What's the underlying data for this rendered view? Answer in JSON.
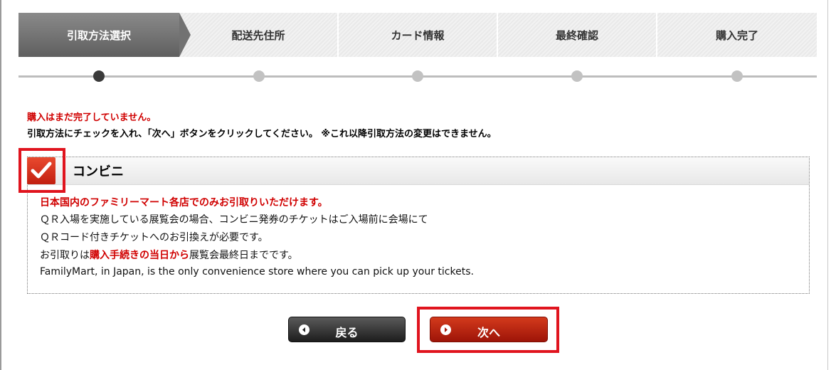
{
  "steps": [
    {
      "label": "引取方法選択",
      "active": true
    },
    {
      "label": "配送先住所",
      "active": false
    },
    {
      "label": "カード情報",
      "active": false
    },
    {
      "label": "最終確認",
      "active": false
    },
    {
      "label": "購入完了",
      "active": false
    }
  ],
  "notice": {
    "warning": "購入はまだ完了していません。",
    "instruction": "引取方法にチェックを入れ、「次へ」ボタンをクリックしてください。 ※これ以降引取方法の変更はできません。"
  },
  "option": {
    "checked": true,
    "label": "コンビニ",
    "note_red": "日本国内のファミリーマート各店でのみお引取りいただけます。",
    "line1": "ＱＲ入場を実施している展覧会の場合、コンビニ発券のチケットはご入場前に会場にて",
    "line2": "ＱＲコード付きチケットへのお引換えが必要です。",
    "line3_prefix": "お引取りは",
    "line3_highlight": "購入手続きの当日から",
    "line3_suffix": "展覧会最終日までです。",
    "line4": "FamilyMart, in Japan, is the only convenience store where you can pick up your tickets."
  },
  "buttons": {
    "back_label": "戻る",
    "next_label": "次へ"
  },
  "colors": {
    "accent_red": "#d00000",
    "highlight_outline": "#e0141e",
    "active_step": "#6e6e6e"
  },
  "icons": {
    "checkbox": "checkmark-icon",
    "back": "arrow-left-circle-icon",
    "next": "arrow-right-circle-icon"
  }
}
